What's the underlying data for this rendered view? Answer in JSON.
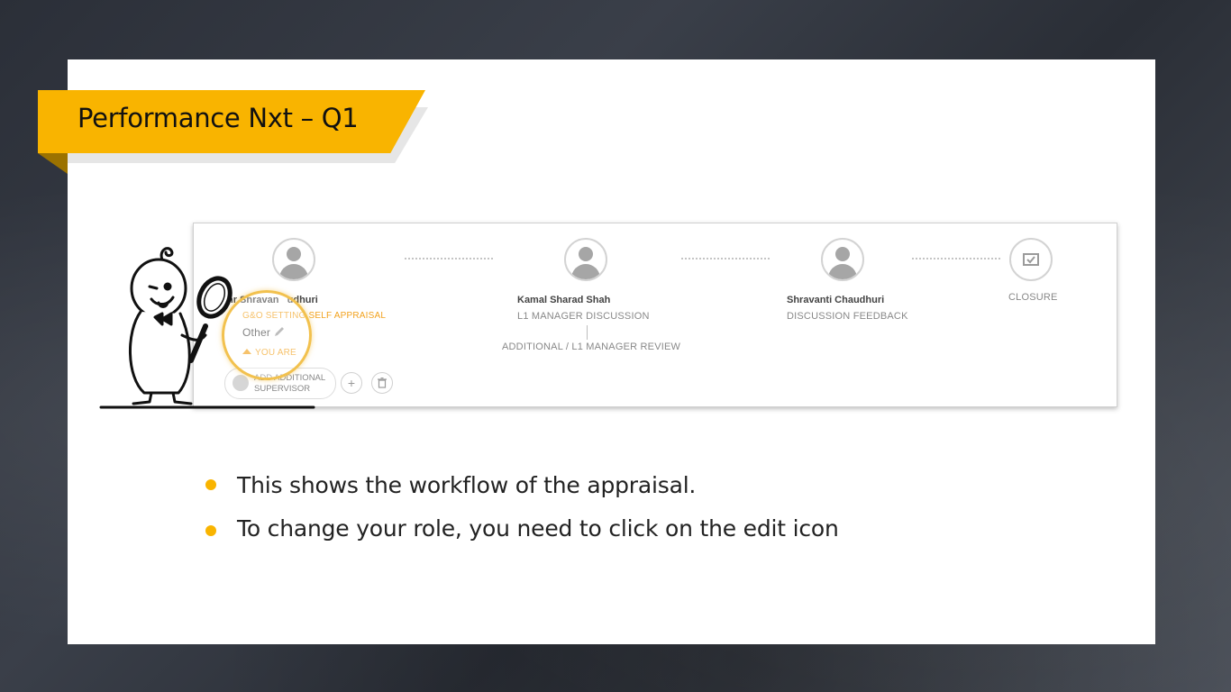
{
  "slide": {
    "title": "Performance Nxt – Q1"
  },
  "workflow": {
    "steps": [
      {
        "name": "Shravanti Chaudhuri",
        "name_visible": "hr Shravan   udhuri",
        "stage": "G&O SETTING SELF APPRAISAL",
        "role_value": "Other",
        "you_are_label": "YOU ARE",
        "icon": "user-avatar-icon"
      },
      {
        "name": "Kamal Sharad Shah",
        "stage": "L1 MANAGER DISCUSSION",
        "sub_stage": "ADDITIONAL / L1 MANAGER REVIEW",
        "icon": "user-avatar-icon"
      },
      {
        "name": "Shravanti Chaudhuri",
        "stage": "DISCUSSION FEEDBACK",
        "icon": "user-avatar-icon"
      },
      {
        "stage": "CLOSURE",
        "icon": "checkbox-icon"
      }
    ],
    "add_supervisor_label": "ADD ADDITIONAL SUPERVISOR",
    "add_icon": "+",
    "delete_icon": "trash-icon"
  },
  "bullets": [
    "This shows the workflow of the appraisal.",
    "To change your role, you need to click on the edit icon"
  ],
  "colors": {
    "accent": "#f9b400",
    "stage_highlight": "#f2a21d",
    "slide_background": "#ffffff",
    "page_background": "#2b2f38"
  }
}
